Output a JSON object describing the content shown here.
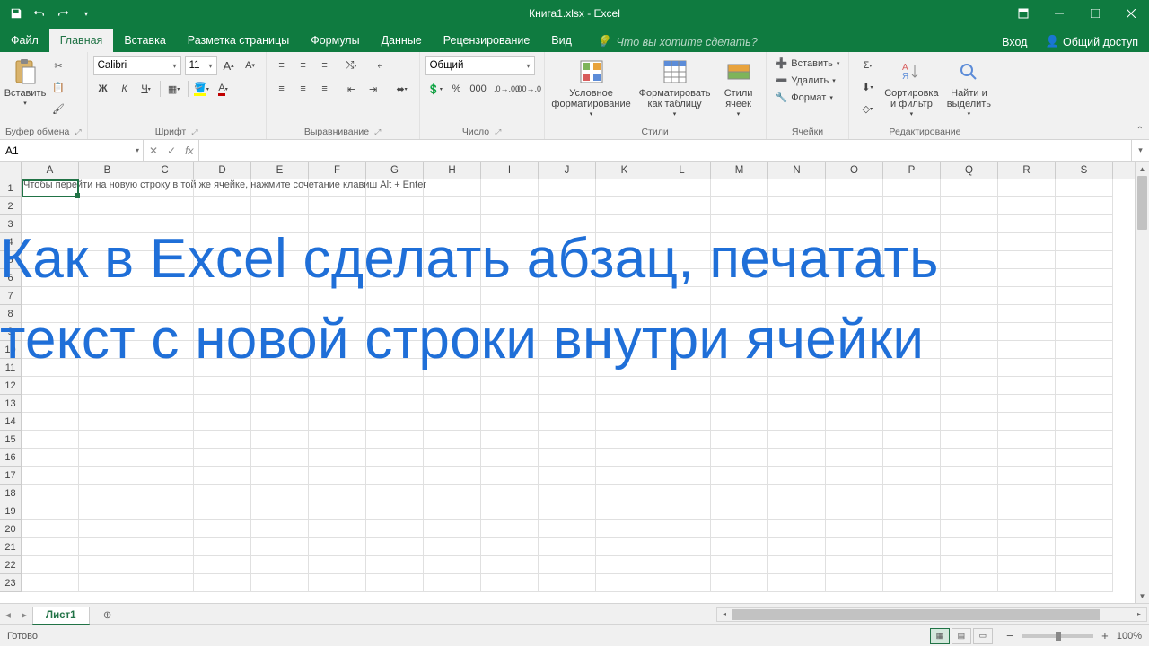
{
  "title": "Книга1.xlsx - Excel",
  "tabs": {
    "file": "Файл",
    "home": "Главная",
    "insert": "Вставка",
    "page_layout": "Разметка страницы",
    "formulas": "Формулы",
    "data": "Данные",
    "review": "Рецензирование",
    "view": "Вид"
  },
  "tell_me": "Что вы хотите сделать?",
  "login": "Вход",
  "share": "Общий доступ",
  "ribbon": {
    "clipboard": {
      "paste": "Вставить",
      "label": "Буфер обмена"
    },
    "font": {
      "name": "Calibri",
      "size": "11",
      "label": "Шрифт"
    },
    "alignment": {
      "label": "Выравнивание"
    },
    "number": {
      "format": "Общий",
      "label": "Число"
    },
    "styles": {
      "conditional": "Условное форматирование",
      "table": "Форматировать как таблицу",
      "cell": "Стили ячеек",
      "label": "Стили"
    },
    "cells": {
      "insert": "Вставить",
      "delete": "Удалить",
      "format": "Формат",
      "label": "Ячейки"
    },
    "editing": {
      "sort": "Сортировка и фильтр",
      "find": "Найти и выделить",
      "label": "Редактирование"
    }
  },
  "name_box": "A1",
  "columns": [
    "A",
    "B",
    "C",
    "D",
    "E",
    "F",
    "G",
    "H",
    "I",
    "J",
    "K",
    "L",
    "M",
    "N",
    "O",
    "P",
    "Q",
    "R",
    "S"
  ],
  "rows": [
    1,
    2,
    3,
    4,
    5,
    6,
    7,
    8,
    9,
    10,
    11,
    12,
    13,
    14,
    15,
    16,
    17,
    18,
    19,
    20,
    21,
    22,
    23
  ],
  "cell_a1": "Чтобы перейти на новую строку в той же ячейке, нажмите сочетание клавиш Alt  +  Enter",
  "overlay_line1": "Как в Excel сделать абзац, печатать",
  "overlay_line2": "текст с новой строки внутри ячейки",
  "sheet_tab": "Лист1",
  "status": "Готово",
  "zoom": "100%"
}
